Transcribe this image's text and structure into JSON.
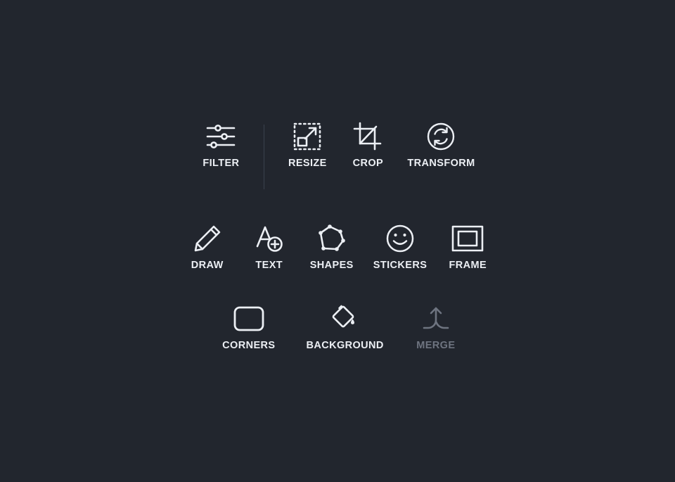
{
  "app": {
    "background_color": "#22262e",
    "icon_color": "#eceff4",
    "disabled_color": "#6e7480",
    "divider_color": "#3b424e"
  },
  "toolbar": {
    "rows": [
      {
        "id": "row-primary",
        "items": [
          {
            "id": "filter",
            "label": "FILTER",
            "icon": "sliders-icon",
            "enabled": true
          },
          {
            "id": "divider",
            "label": "",
            "icon": "vertical-divider",
            "enabled": false
          },
          {
            "id": "resize",
            "label": "RESIZE",
            "icon": "resize-arrow-icon",
            "enabled": true
          },
          {
            "id": "crop",
            "label": "CROP",
            "icon": "crop-icon",
            "enabled": true
          },
          {
            "id": "transform",
            "label": "TRANSFORM",
            "icon": "transform-refresh-icon",
            "enabled": true
          }
        ]
      },
      {
        "id": "row-creative",
        "items": [
          {
            "id": "draw",
            "label": "DRAW",
            "icon": "pencil-icon",
            "enabled": true
          },
          {
            "id": "text",
            "label": "TEXT",
            "icon": "text-add-icon",
            "enabled": true
          },
          {
            "id": "shapes",
            "label": "SHAPES",
            "icon": "polygon-icon",
            "enabled": true
          },
          {
            "id": "stickers",
            "label": "STICKERS",
            "icon": "smiley-icon",
            "enabled": true
          },
          {
            "id": "frame",
            "label": "FRAME",
            "icon": "picture-frame-icon",
            "enabled": true
          }
        ]
      },
      {
        "id": "row-surface",
        "items": [
          {
            "id": "corners",
            "label": "CORNERS",
            "icon": "rounded-rectangle-icon",
            "enabled": true
          },
          {
            "id": "background",
            "label": "BACKGROUND",
            "icon": "paint-bucket-icon",
            "enabled": true
          },
          {
            "id": "merge",
            "label": "MERGE",
            "icon": "merge-arrow-icon",
            "enabled": false
          }
        ]
      }
    ]
  }
}
